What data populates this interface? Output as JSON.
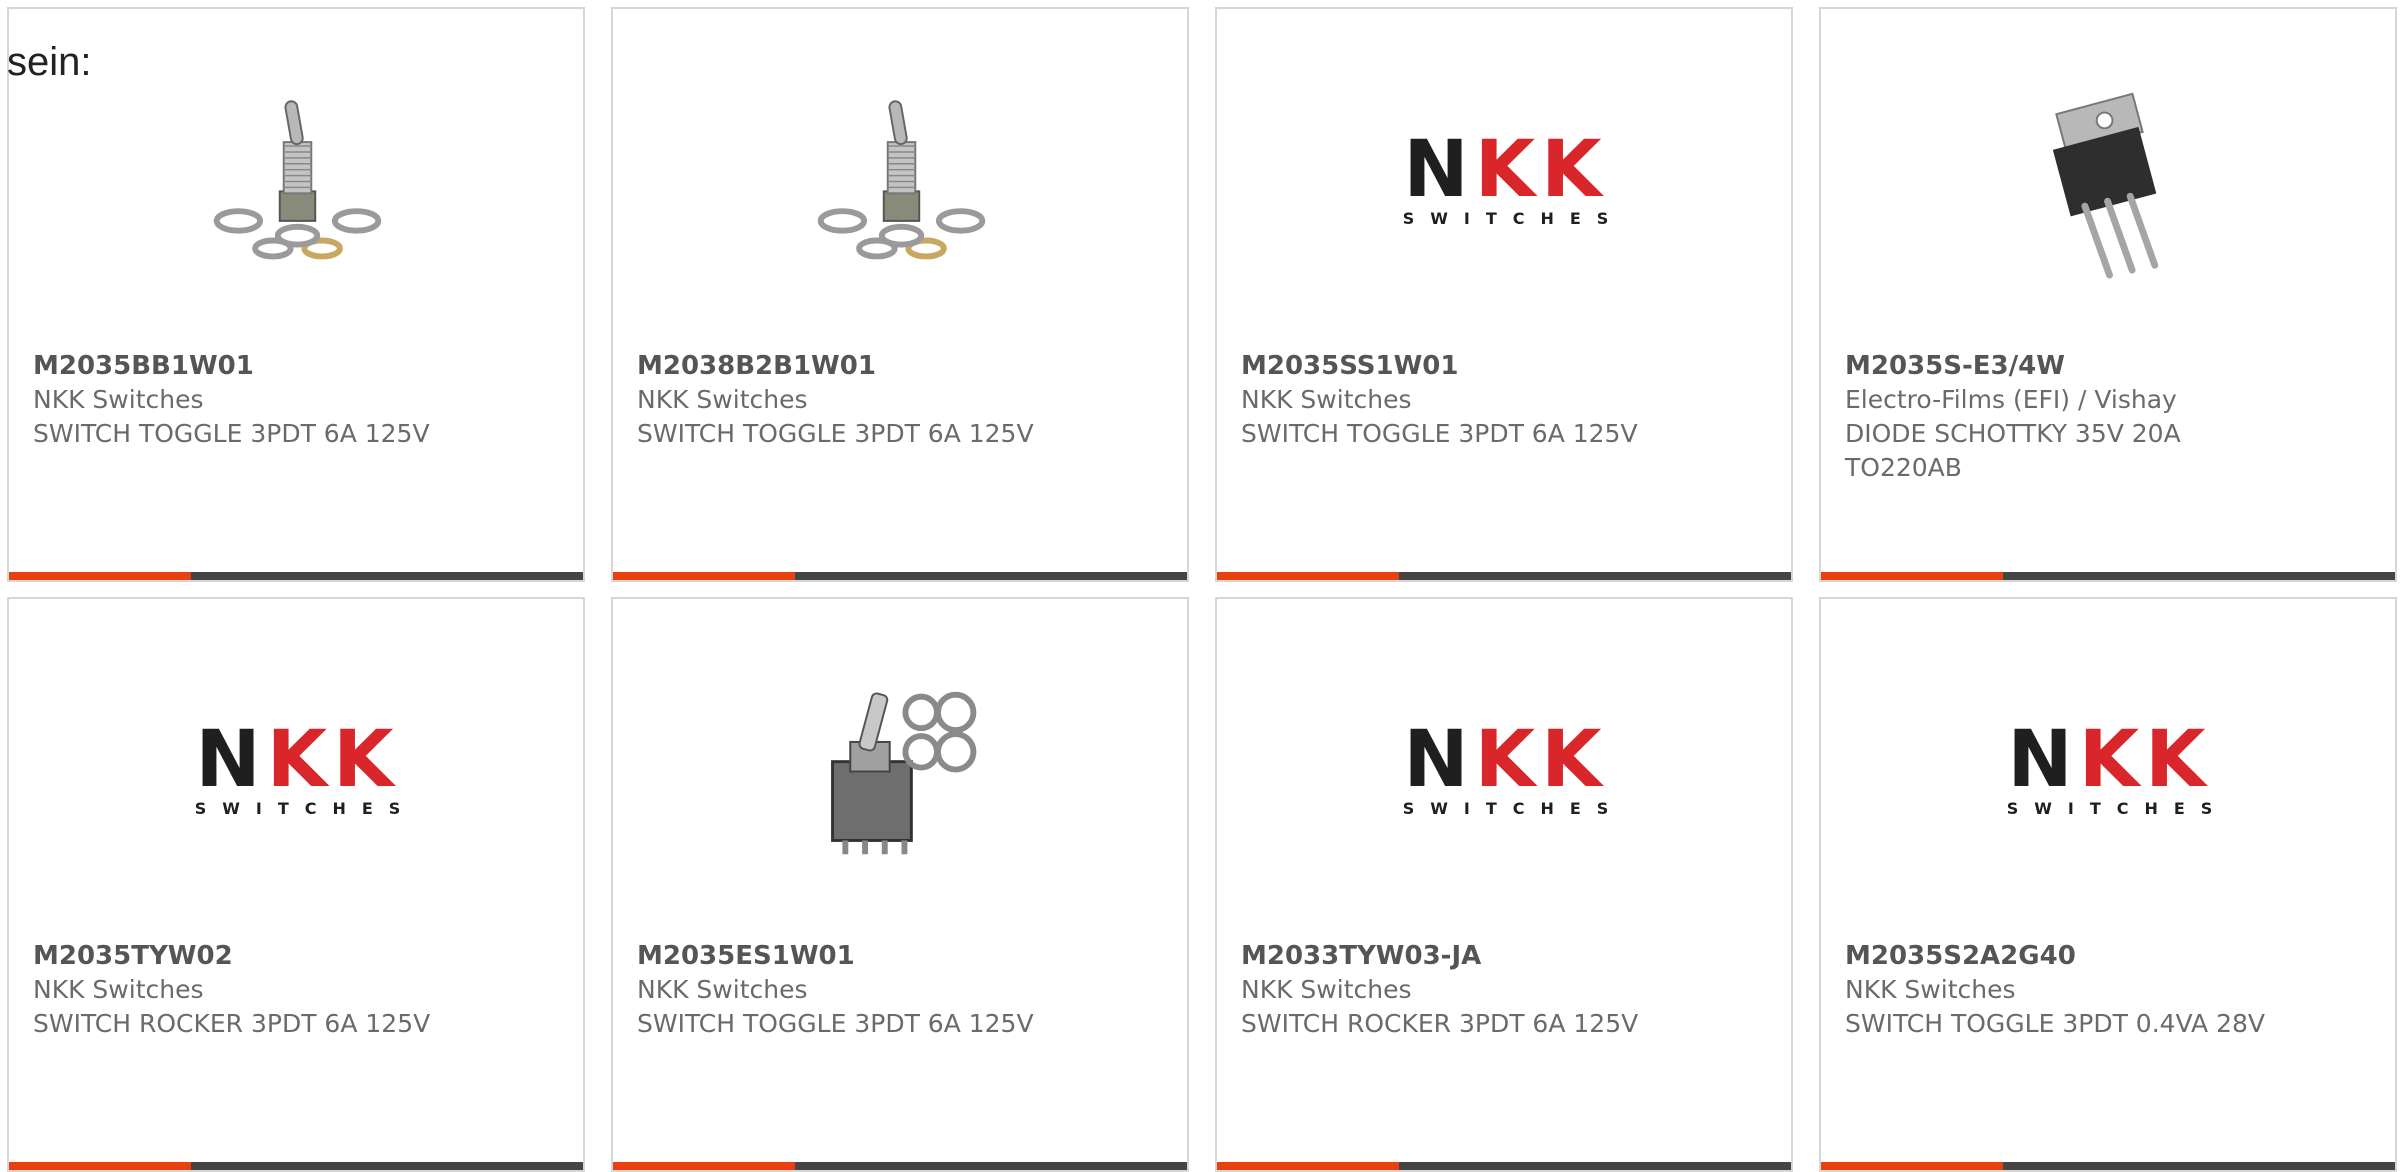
{
  "intro_text": "sein:",
  "colors": {
    "accent": "#e8400e",
    "bar_dark": "#444444",
    "logo_dark": "#1f1f1f",
    "logo_red": "#d9262a"
  },
  "logo": {
    "letters": [
      "N",
      "K",
      "K"
    ],
    "subtitle": "SWITCHES"
  },
  "products": [
    {
      "part": "M2035BB1W01",
      "maker": "NKK Switches",
      "desc": "SWITCH TOGGLE 3PDT 6A 125V",
      "image": "toggle-switch-photo-icon"
    },
    {
      "part": "M2038B2B1W01",
      "maker": "NKK Switches",
      "desc": "SWITCH TOGGLE 3PDT 6A 125V",
      "image": "toggle-switch-photo-icon"
    },
    {
      "part": "M2035SS1W01",
      "maker": "NKK Switches",
      "desc": "SWITCH TOGGLE 3PDT 6A 125V",
      "image": "nkk-logo"
    },
    {
      "part": "M2035S-E3/4W",
      "maker": "Electro-Films (EFI) / Vishay",
      "desc": "DIODE SCHOTTKY 35V 20A TO220AB",
      "image": "to220-diode-photo-icon"
    },
    {
      "part": "M2035TYW02",
      "maker": "NKK Switches",
      "desc": "SWITCH ROCKER 3PDT 6A 125V",
      "image": "nkk-logo"
    },
    {
      "part": "M2035ES1W01",
      "maker": "NKK Switches",
      "desc": "SWITCH TOGGLE 3PDT 6A 125V",
      "image": "toggle-switch-kit-photo-icon"
    },
    {
      "part": "M2033TYW03-JA",
      "maker": "NKK Switches",
      "desc": "SWITCH ROCKER 3PDT 6A 125V",
      "image": "nkk-logo"
    },
    {
      "part": "M2035S2A2G40",
      "maker": "NKK Switches",
      "desc": "SWITCH TOGGLE 3PDT 0.4VA 28V",
      "image": "nkk-logo"
    }
  ]
}
